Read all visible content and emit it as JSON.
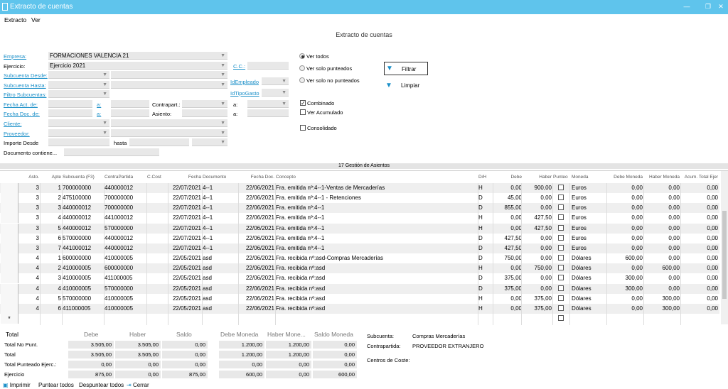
{
  "window": {
    "title": "Extracto de cuentas"
  },
  "menu": {
    "extracto": "Extracto",
    "ver": "Ver"
  },
  "form": {
    "title": "Extracto de cuentas",
    "empresa_label": "Empresa:",
    "empresa_value": "FORMACIONES VALENCIA 21",
    "ejercicio_label": "Ejercicio:",
    "ejercicio_value": "Ejercicio 2021",
    "subcuenta_desde_label": "Subcuenta Desde:",
    "subcuenta_hasta_label": "Subcuenta Hasta:",
    "filtro_subcuentas_label": "Filtro Subcuentas:",
    "fecha_act_label": "Fecha Act. de:",
    "fecha_act_a": "a:",
    "fecha_doc_label": "Fecha Doc. de:",
    "fecha_doc_a": "a:",
    "cliente_label": "Cliente:",
    "proveedor_label": "Proveedor:",
    "importe_label": "Importe Desde",
    "hasta_label": "hasta",
    "documento_label": "Documento contiene...",
    "contrapart_label": "Contrapart.:",
    "asiento_label": "Asiento:",
    "cc_label": "C.C.:",
    "idempleado_label": "IdEmpleado",
    "idtipogasto_label": "IdTipoGasto",
    "a_label": "a:",
    "a_label2": "a:",
    "radio_ver_todos": "Ver todos",
    "radio_punteados": "Ver solo punteados",
    "radio_no_punteados": "Ver solo no punteados",
    "chk_combinado": "Combinado",
    "chk_acumulado": "Ver Acumulado",
    "chk_consolidado": "Consolidado",
    "filtrar": "Filtrar",
    "limpiar": "Limpiar"
  },
  "grid": {
    "caption": "17 Gestión de Asientos",
    "headers": {
      "asto": "Asto.",
      "apte": "Apte",
      "subcuenta": "Subcuenta (F3)",
      "contrapartida": "ContraPartida",
      "ccost": "C.Cost",
      "fecha": "Fecha",
      "documento": "Documento",
      "fechadoc": "Fecha Doc.",
      "concepto": "Concepto",
      "dh": "D/H",
      "debe": "Debe",
      "haber": "Haber",
      "punteo": "Punteo",
      "moneda": "Moneda",
      "debemoneda": "Debe Moneda",
      "habermoneda": "Haber Moneda",
      "acum": "Acum. Total Ejer"
    },
    "rows": [
      {
        "asto": "3",
        "apte": "1",
        "sub": "700000000",
        "cp": "440000012",
        "fecha": "22/07/2021",
        "doc": "4--1",
        "fdoc": "22/06/2021",
        "concepto": "Fra. emitida nº:4--1-Ventas de Mercaderías",
        "dh": "H",
        "debe": "0,00",
        "haber": "900,00",
        "moneda": "Euros",
        "dm": "0,00",
        "hm": "0,00",
        "acum": "0,00"
      },
      {
        "asto": "3",
        "apte": "2",
        "sub": "475100000",
        "cp": "700000000",
        "fecha": "22/07/2021",
        "doc": "4--1",
        "fdoc": "22/06/2021",
        "concepto": "Fra. emitida nº:4--1 - Retenciones",
        "dh": "D",
        "debe": "45,00",
        "haber": "0,00",
        "moneda": "Euros",
        "dm": "0,00",
        "hm": "0,00",
        "acum": "0,00"
      },
      {
        "asto": "3",
        "apte": "3",
        "sub": "440000012",
        "cp": "700000000",
        "fecha": "22/07/2021",
        "doc": "4--1",
        "fdoc": "22/06/2021",
        "concepto": "Fra. emitida nº:4--1",
        "dh": "D",
        "debe": "855,00",
        "haber": "0,00",
        "moneda": "Euros",
        "dm": "0,00",
        "hm": "0,00",
        "acum": "0,00"
      },
      {
        "asto": "3",
        "apte": "4",
        "sub": "440000012",
        "cp": "441000012",
        "fecha": "22/07/2021",
        "doc": "4--1",
        "fdoc": "22/06/2021",
        "concepto": "Fra. emitida nº:4--1",
        "dh": "H",
        "debe": "0,00",
        "haber": "427,50",
        "moneda": "Euros",
        "dm": "0,00",
        "hm": "0,00",
        "acum": "0,00"
      },
      {
        "asto": "3",
        "apte": "5",
        "sub": "440000012",
        "cp": "570000000",
        "fecha": "22/07/2021",
        "doc": "4--1",
        "fdoc": "22/06/2021",
        "concepto": "Fra. emitida nº:4--1",
        "dh": "H",
        "debe": "0,00",
        "haber": "427,50",
        "moneda": "Euros",
        "dm": "0,00",
        "hm": "0,00",
        "acum": "0,00"
      },
      {
        "asto": "3",
        "apte": "6",
        "sub": "570000000",
        "cp": "440000012",
        "fecha": "22/07/2021",
        "doc": "4--1",
        "fdoc": "22/06/2021",
        "concepto": "Fra. emitida nº:4--1",
        "dh": "D",
        "debe": "427,50",
        "haber": "0,00",
        "moneda": "Euros",
        "dm": "0,00",
        "hm": "0,00",
        "acum": "0,00"
      },
      {
        "asto": "3",
        "apte": "7",
        "sub": "441000012",
        "cp": "440000012",
        "fecha": "22/07/2021",
        "doc": "4--1",
        "fdoc": "22/06/2021",
        "concepto": "Fra. emitida nº:4--1",
        "dh": "D",
        "debe": "427,50",
        "haber": "0,00",
        "moneda": "Euros",
        "dm": "0,00",
        "hm": "0,00",
        "acum": "0,00"
      },
      {
        "asto": "4",
        "apte": "1",
        "sub": "600000000",
        "cp": "410000005",
        "fecha": "22/05/2021",
        "doc": "asd",
        "fdoc": "22/06/2021",
        "concepto": "Fra. recibida nº:asd-Compras Mercaderías",
        "dh": "D",
        "debe": "750,00",
        "haber": "0,00",
        "moneda": "Dólares",
        "dm": "600,00",
        "hm": "0,00",
        "acum": "0,00"
      },
      {
        "asto": "4",
        "apte": "2",
        "sub": "410000005",
        "cp": "600000000",
        "fecha": "22/05/2021",
        "doc": "asd",
        "fdoc": "22/06/2021",
        "concepto": "Fra. recibida nº:asd",
        "dh": "H",
        "debe": "0,00",
        "haber": "750,00",
        "moneda": "Dólares",
        "dm": "0,00",
        "hm": "600,00",
        "acum": "0,00"
      },
      {
        "asto": "4",
        "apte": "3",
        "sub": "410000005",
        "cp": "411000005",
        "fecha": "22/05/2021",
        "doc": "asd",
        "fdoc": "22/06/2021",
        "concepto": "Fra. recibida nº:asd",
        "dh": "D",
        "debe": "375,00",
        "haber": "0,00",
        "moneda": "Dólares",
        "dm": "300,00",
        "hm": "0,00",
        "acum": "0,00"
      },
      {
        "asto": "4",
        "apte": "4",
        "sub": "410000005",
        "cp": "570000000",
        "fecha": "22/05/2021",
        "doc": "asd",
        "fdoc": "22/06/2021",
        "concepto": "Fra. recibida nº:asd",
        "dh": "D",
        "debe": "375,00",
        "haber": "0,00",
        "moneda": "Dólares",
        "dm": "300,00",
        "hm": "0,00",
        "acum": "0,00"
      },
      {
        "asto": "4",
        "apte": "5",
        "sub": "570000000",
        "cp": "410000005",
        "fecha": "22/05/2021",
        "doc": "asd",
        "fdoc": "22/06/2021",
        "concepto": "Fra. recibida nº:asd",
        "dh": "H",
        "debe": "0,00",
        "haber": "375,00",
        "moneda": "Dólares",
        "dm": "0,00",
        "hm": "300,00",
        "acum": "0,00"
      },
      {
        "asto": "4",
        "apte": "6",
        "sub": "411000005",
        "cp": "410000005",
        "fecha": "22/05/2021",
        "doc": "asd",
        "fdoc": "22/06/2021",
        "concepto": "Fra. recibida nº:asd",
        "dh": "H",
        "debe": "0,00",
        "haber": "375,00",
        "moneda": "Dólares",
        "dm": "0,00",
        "hm": "300,00",
        "acum": "0,00"
      }
    ],
    "new_row_marker": "*"
  },
  "totals": {
    "headers": {
      "total": "Total",
      "debe": "Debe",
      "haber": "Haber",
      "saldo": "Saldo",
      "debe_moneda": "Debe Moneda",
      "haber_moneda": "Haber Mone...",
      "saldo_moneda": "Saldo Moneda"
    },
    "rows": [
      {
        "label": "Total No Punt.",
        "debe": "3.505,00",
        "haber": "3.505,00",
        "saldo": "0,00",
        "dm": "1.200,00",
        "hm": "1.200,00",
        "sm": "0,00"
      },
      {
        "label": "Total",
        "debe": "3.505,00",
        "haber": "3.505,00",
        "saldo": "0,00",
        "dm": "1.200,00",
        "hm": "1.200,00",
        "sm": "0,00"
      },
      {
        "label": "Total Punteado Ejerc.:",
        "debe": "0,00",
        "haber": "0,00",
        "saldo": "0,00",
        "dm": "0,00",
        "hm": "0,00",
        "sm": "0,00"
      },
      {
        "label": "Ejercicio",
        "debe": "875,00",
        "haber": "0,00",
        "saldo": "875,00",
        "dm": "600,00",
        "hm": "0,00",
        "sm": "600,00"
      }
    ],
    "subcuenta_label": "Subcuenta:",
    "subcuenta_value": "Compras Mercaderías",
    "contrapartida_label": "Contrapartida:",
    "contrapartida_value": "PROVEEDOR EXTRANJERO",
    "centros_label": "Centros de Coste:"
  },
  "bottom": {
    "imprimir": "Imprimir",
    "puntear": "Puntear todos",
    "despuntear": "Despuntear todos",
    "cerrar": "Cerrar"
  }
}
